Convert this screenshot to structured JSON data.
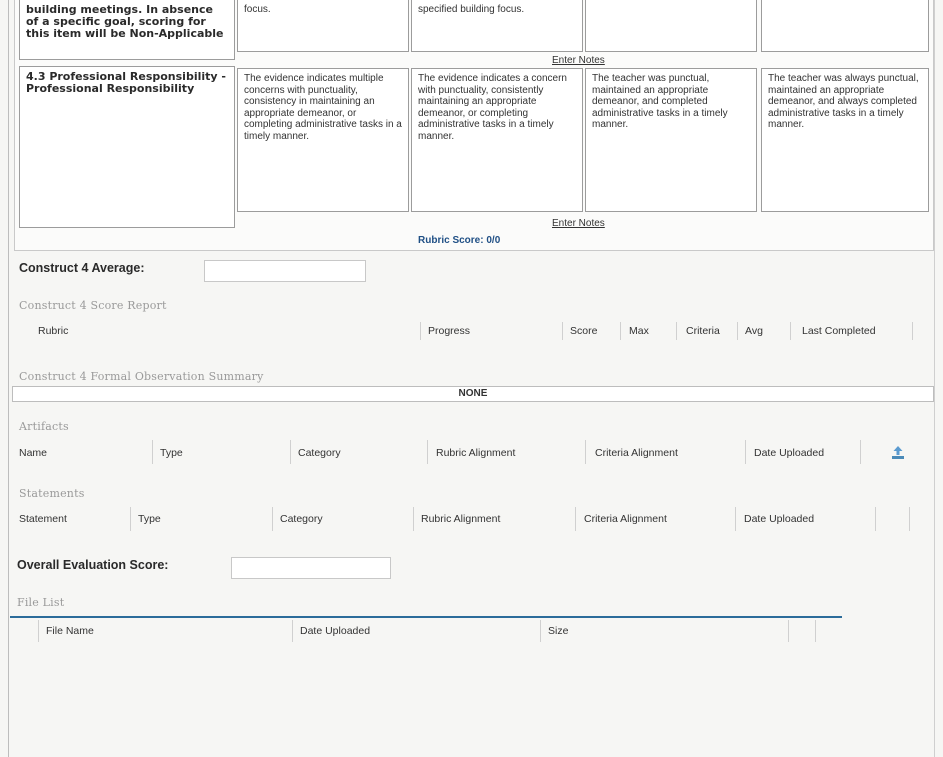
{
  "rubric": {
    "row1": {
      "criteria_text": "building meetings. In absence of a specific goal, scoring for this item will be Non-Applicable",
      "levels": [
        "focus.",
        "specified building focus.",
        "",
        ""
      ],
      "enter_notes": "Enter Notes"
    },
    "row2": {
      "criteria_text": "4.3 Professional Responsibility - Professional Responsibility",
      "levels": [
        "The evidence indicates multiple concerns with punctuality, consistency in maintaining an appropriate demeanor, or completing administrative tasks in a timely manner.",
        "The evidence indicates a concern with punctuality, consistently maintaining an appropriate demeanor, or completing administrative tasks in a timely manner.",
        "The teacher was punctual, maintained an appropriate demeanor, and completed administrative tasks in a timely manner.",
        "The teacher was always punctual, maintained an appropriate demeanor, and always completed administrative tasks in a timely manner."
      ],
      "enter_notes": "Enter Notes"
    },
    "rubric_score": "Rubric Score: 0/0"
  },
  "construct_average": {
    "label": "Construct 4 Average:",
    "value": ""
  },
  "score_report": {
    "title": "Construct 4 Score Report",
    "columns": [
      "Rubric",
      "Progress",
      "Score",
      "Max",
      "Criteria",
      "Avg",
      "Last Completed"
    ]
  },
  "formal_observation": {
    "title": "Construct 4 Formal Observation Summary",
    "none_text": "NONE"
  },
  "artifacts": {
    "title": "Artifacts",
    "columns": [
      "Name",
      "Type",
      "Category",
      "Rubric Alignment",
      "Criteria Alignment",
      "Date Uploaded"
    ],
    "upload_icon": "upload-icon"
  },
  "statements": {
    "title": "Statements",
    "columns": [
      "Statement",
      "Type",
      "Category",
      "Rubric Alignment",
      "Criteria Alignment",
      "Date Uploaded"
    ]
  },
  "overall_score": {
    "label": "Overall Evaluation Score:",
    "value": ""
  },
  "file_list": {
    "title": "File List",
    "columns": [
      "File Name",
      "Date Uploaded",
      "Size"
    ]
  },
  "colors": {
    "accent_blue": "#2c6c9a",
    "score_blue": "#1f4f85"
  }
}
